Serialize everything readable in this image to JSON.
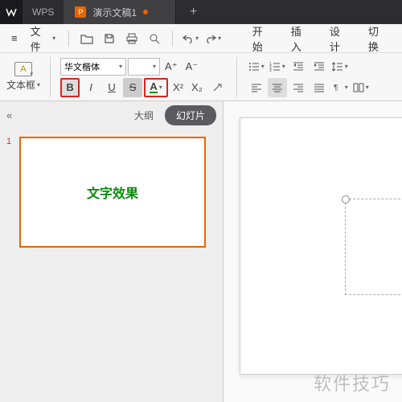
{
  "app": {
    "name": "WPS"
  },
  "tab": {
    "title": "演示文稿1",
    "new": "+"
  },
  "menu": {
    "hamburger": "≡",
    "file": "文件",
    "start": "开始",
    "insert": "插入",
    "design": "设计",
    "switch": "切换"
  },
  "ribbon": {
    "textbox": "文本框",
    "font": "华文楷体",
    "bold": "B",
    "italic": "I",
    "underline": "U",
    "strike": "S",
    "fontcolor": "A",
    "increase": "A⁺",
    "decrease": "A⁻",
    "super": "X²",
    "sub": "X₂"
  },
  "sidebar": {
    "outline": "大纲",
    "slides": "幻灯片",
    "collapse": "«"
  },
  "thumb": {
    "num": "1",
    "text": "文字效果"
  },
  "watermark": "软件技巧"
}
